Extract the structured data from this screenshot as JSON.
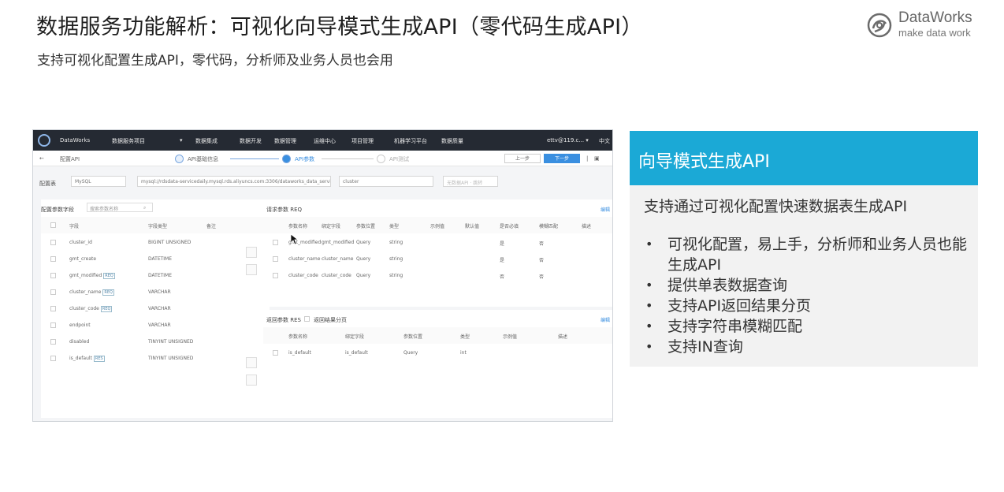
{
  "slide": {
    "title": "数据服务功能解析：可视化向导模式生成API（零代码生成API）",
    "subtitle": "支持可视化配置生成API，零代码，分析师及业务人员也会用"
  },
  "brand": {
    "name": "DataWorks",
    "tagline": "make data work",
    "icon": "dataworks-logo-icon",
    "color": "#6b6b6b"
  },
  "screenshot": {
    "topbar": {
      "product": "DataWorks",
      "project": "数据服务项目",
      "menu": [
        "数据集成",
        "数据开发",
        "数据管理",
        "运维中心",
        "项目管理",
        "机器学习平台",
        "数据质量"
      ],
      "account": "ettv@119.c... ▾",
      "lang": "中文"
    },
    "crumb": {
      "back": "←",
      "title": "配置API",
      "steps": [
        "API基础信息",
        "API参数",
        "API测试"
      ],
      "prev": "上一步",
      "next": "下一步"
    },
    "config": {
      "table_label": "配置表",
      "datasource_type": "MySQL",
      "datasource": "mysql://rdsdata-servicedaily.mysql.rds.aliyuncs.com:3306/dataworks_data_service",
      "table": "cluster",
      "button": "无数据API · 跳转"
    },
    "left": {
      "title": "配置参数字段",
      "search_placeholder": "搜索参数名称",
      "headers": [
        "字段",
        "字段类型",
        "备注"
      ],
      "rows": [
        {
          "field": "cluster_id",
          "type": "BIGINT UNSIGNED",
          "tag": ""
        },
        {
          "field": "gmt_create",
          "type": "DATETIME",
          "tag": ""
        },
        {
          "field": "gmt_modified",
          "type": "DATETIME",
          "tag": "REQ"
        },
        {
          "field": "cluster_name",
          "type": "VARCHAR",
          "tag": "REQ"
        },
        {
          "field": "cluster_code",
          "type": "VARCHAR",
          "tag": "REQ"
        },
        {
          "field": "endpoint",
          "type": "VARCHAR",
          "tag": ""
        },
        {
          "field": "disabled",
          "type": "TINYINT UNSIGNED",
          "tag": ""
        },
        {
          "field": "is_default",
          "type": "TINYINT UNSIGNED",
          "tag": "RES"
        }
      ]
    },
    "req": {
      "title": "请求参数 REQ",
      "edit": "编辑",
      "headers": [
        "参数名称",
        "绑定字段",
        "参数位置",
        "类型",
        "示例值",
        "默认值",
        "是否必填",
        "模糊匹配",
        "描述"
      ],
      "rows": [
        {
          "name": "gmt_modified",
          "bind": "gmt_modified",
          "pos": "Query",
          "type": "string",
          "required": "是",
          "fuzzy": "否"
        },
        {
          "name": "cluster_name",
          "bind": "cluster_name",
          "pos": "Query",
          "type": "string",
          "required": "是",
          "fuzzy": "否"
        },
        {
          "name": "cluster_code",
          "bind": "cluster_code",
          "pos": "Query",
          "type": "string",
          "required": "否",
          "fuzzy": "否"
        }
      ]
    },
    "res": {
      "title": "返回参数 RES",
      "paging": "返回结果分页",
      "edit": "编辑",
      "headers": [
        "参数名称",
        "绑定字段",
        "参数位置",
        "类型",
        "示例值",
        "描述"
      ],
      "rows": [
        {
          "name": "is_default",
          "bind": "is_default",
          "pos": "Query",
          "type": "int"
        }
      ]
    }
  },
  "card": {
    "header": "向导模式生成API",
    "header_color": "#1ba9d6",
    "lead": "支持通过可视化配置快速数据表生成API",
    "bullet_char": "•",
    "bullets": [
      "可视化配置，易上手，分析师和业务人员也能生成API",
      "提供单表数据查询",
      "支持API返回结果分页",
      "支持字符串模糊匹配",
      "支持IN查询"
    ]
  }
}
